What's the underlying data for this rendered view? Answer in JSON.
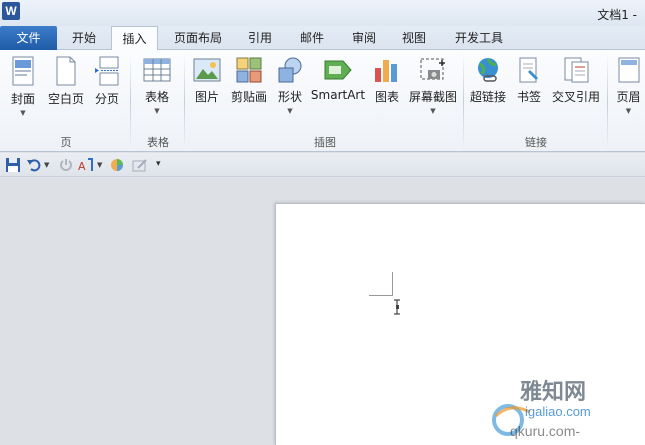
{
  "titlebar": {
    "app_icon": "W",
    "doc_title": "文档1 -"
  },
  "tabs": [
    {
      "label": "文件"
    },
    {
      "label": "开始"
    },
    {
      "label": "插入"
    },
    {
      "label": "页面布局"
    },
    {
      "label": "引用"
    },
    {
      "label": "邮件"
    },
    {
      "label": "审阅"
    },
    {
      "label": "视图"
    },
    {
      "label": "开发工具"
    }
  ],
  "ribbon": {
    "groups": {
      "pages": "页",
      "tables": "表格",
      "illustrations": "插图",
      "links": "链接"
    },
    "buttons": {
      "cover": "封面",
      "blank_page": "空白页",
      "page_break": "分页",
      "table": "表格",
      "picture": "图片",
      "clipart": "剪贴画",
      "shapes": "形状",
      "smartart": "SmartArt",
      "chart": "图表",
      "screenshot": "屏幕截图",
      "hyperlink": "超链接",
      "bookmark": "书签",
      "cross_ref": "交叉引用",
      "header": "页眉"
    }
  },
  "watermark": {
    "line1": "雅知网",
    "line2": "igaliao.com",
    "line3": "qkuru.com-"
  },
  "colors": {
    "file_tab": "#2b64b3",
    "word_blue": "#2b579a"
  }
}
